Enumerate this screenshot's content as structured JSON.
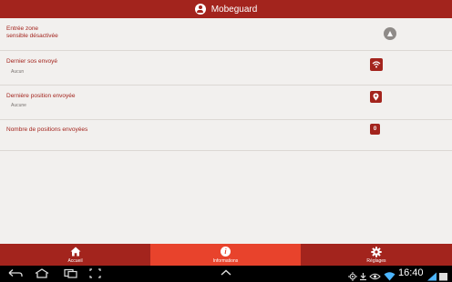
{
  "app": {
    "title": "Mobeguard"
  },
  "rows": [
    {
      "title_line1": "Entrée zone",
      "title_line2": "sensible désactivée",
      "icon": "warning-icon"
    },
    {
      "title": "Dernier sos envoyé",
      "value": "Aucun",
      "icon": "signal-icon"
    },
    {
      "title": "Dernière position envoyée",
      "value": "Aucune",
      "icon": "location-pin-icon"
    },
    {
      "title": "Nombre de positions envoyées",
      "badge": "0"
    }
  ],
  "nav": {
    "items": [
      {
        "label": "Accueil",
        "icon": "home-icon",
        "active": false
      },
      {
        "label": "Informations",
        "icon": "info-icon",
        "active": true
      },
      {
        "label": "Réglages",
        "icon": "gear-icon",
        "active": false
      }
    ]
  },
  "system_bar": {
    "time": "16:40"
  },
  "colors": {
    "brand": "#a3241d",
    "active_tab": "#e8432c",
    "background": "#f2f0ee"
  }
}
